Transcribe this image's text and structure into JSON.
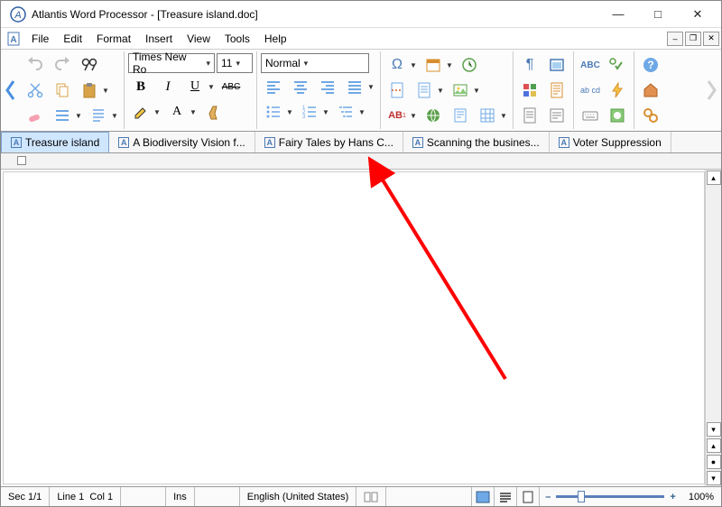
{
  "window": {
    "title": "Atlantis Word Processor - [Treasure island.doc]"
  },
  "menu": {
    "items": [
      "File",
      "Edit",
      "Format",
      "Insert",
      "View",
      "Tools",
      "Help"
    ]
  },
  "formatting": {
    "font": "Times New Ro",
    "size": "11",
    "style": "Normal"
  },
  "tabs": [
    {
      "label": "Treasure island",
      "active": true
    },
    {
      "label": "A Biodiversity Vision f...",
      "active": false
    },
    {
      "label": "Fairy Tales by Hans C...",
      "active": false
    },
    {
      "label": "Scanning the busines...",
      "active": false
    },
    {
      "label": "Voter Suppression",
      "active": false
    }
  ],
  "status": {
    "section": "Sec 1/1",
    "line": "Line 1",
    "col": "Col 1",
    "ins": "Ins",
    "lang": "English (United States)",
    "zoom": "100%"
  },
  "glyphs": {
    "min": "—",
    "max": "□",
    "close": "✕",
    "bold": "B",
    "italic": "I",
    "underline": "U",
    "strike": "ABC",
    "omega": "Ω",
    "pilcrow": "¶",
    "abc_check": "ABC",
    "ab1": "AB",
    "abcd": "ab cd",
    "plus": "+",
    "minus": "–"
  }
}
